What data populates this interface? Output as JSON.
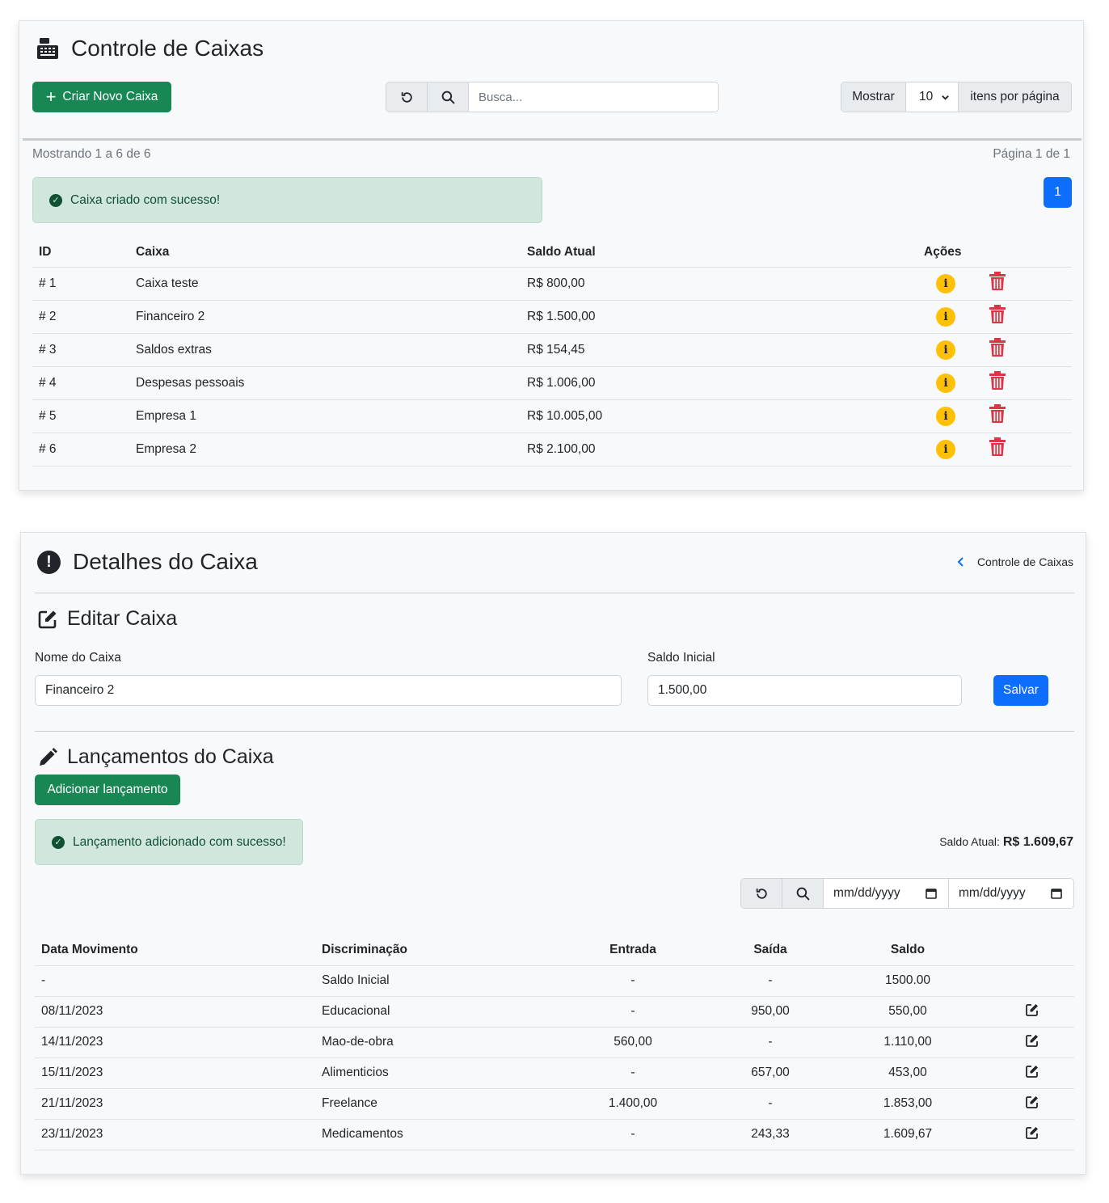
{
  "caixas": {
    "title": "Controle de Caixas",
    "create_button": "Criar Novo Caixa",
    "search_placeholder": "Busca...",
    "show_label": "Mostrar",
    "per_page_value": "10",
    "per_page_suffix": "itens por página",
    "showing": "Mostrando 1 a 6 de 6",
    "page_info": "Página 1 de 1",
    "alert": "Caixa criado com sucesso!",
    "current_page": "1",
    "headers": [
      "ID",
      "Caixa",
      "Saldo Atual",
      "Ações"
    ],
    "rows": [
      {
        "id": "# 1",
        "nome": "Caixa teste",
        "saldo": "R$ 800,00"
      },
      {
        "id": "# 2",
        "nome": "Financeiro 2",
        "saldo": "R$ 1.500,00"
      },
      {
        "id": "# 3",
        "nome": "Saldos extras",
        "saldo": "R$ 154,45"
      },
      {
        "id": "# 4",
        "nome": "Despesas pessoais",
        "saldo": "R$ 1.006,00"
      },
      {
        "id": "# 5",
        "nome": "Empresa 1",
        "saldo": "R$ 10.005,00"
      },
      {
        "id": "# 6",
        "nome": "Empresa 2",
        "saldo": "R$ 2.100,00"
      }
    ]
  },
  "detalhes": {
    "title": "Detalhes do Caixa",
    "back_link": "Controle de Caixas",
    "edit_title": "Editar Caixa",
    "nome_label": "Nome do Caixa",
    "nome_value": "Financeiro 2",
    "saldo_label": "Saldo Inicial",
    "saldo_value": "1.500,00",
    "save_button": "Salvar",
    "lanc_title": "Lançamentos do Caixa",
    "add_button": "Adicionar lançamento",
    "alert": "Lançamento adicionado com sucesso!",
    "saldo_atual_label": "Saldo Atual:",
    "saldo_atual_value": "R$ 1.609,67",
    "date_placeholder_1": "mm/dd/yyyy",
    "date_placeholder_2": "mm/dd/yyyy",
    "headers": [
      "Data Movimento",
      "Discriminação",
      "Entrada",
      "Saída",
      "Saldo"
    ],
    "rows": [
      {
        "data": "-",
        "desc": "Saldo Inicial",
        "entrada": "-",
        "saida": "-",
        "saldo": "1500.00",
        "editable": false
      },
      {
        "data": "08/11/2023",
        "desc": "Educacional",
        "entrada": "-",
        "saida": "950,00",
        "saldo": "550,00",
        "editable": true
      },
      {
        "data": "14/11/2023",
        "desc": "Mao-de-obra",
        "entrada": "560,00",
        "saida": "-",
        "saldo": "1.110,00",
        "editable": true
      },
      {
        "data": "15/11/2023",
        "desc": "Alimenticios",
        "entrada": "-",
        "saida": "657,00",
        "saldo": "453,00",
        "editable": true
      },
      {
        "data": "21/11/2023",
        "desc": "Freelance",
        "entrada": "1.400,00",
        "saida": "-",
        "saldo": "1.853,00",
        "editable": true
      },
      {
        "data": "23/11/2023",
        "desc": "Medicamentos",
        "entrada": "-",
        "saida": "243,33",
        "saldo": "1.609,67",
        "editable": true
      }
    ]
  },
  "icons": {
    "cash_register": "cash-register-icon",
    "plus": "plus-icon",
    "refresh": "refresh-icon",
    "search": "search-icon",
    "check": "check-circle-icon",
    "info": "info-circle-icon",
    "trash": "trash-icon",
    "exclamation": "exclamation-circle-icon",
    "chevron_left": "chevron-left-icon",
    "edit": "edit-icon",
    "pencil": "pencil-icon",
    "calendar": "calendar-icon"
  },
  "colors": {
    "success": "#198754",
    "primary": "#0d6efd",
    "warning": "#ffc107",
    "danger": "#dc3545",
    "alert_bg": "#d1e7dd"
  }
}
